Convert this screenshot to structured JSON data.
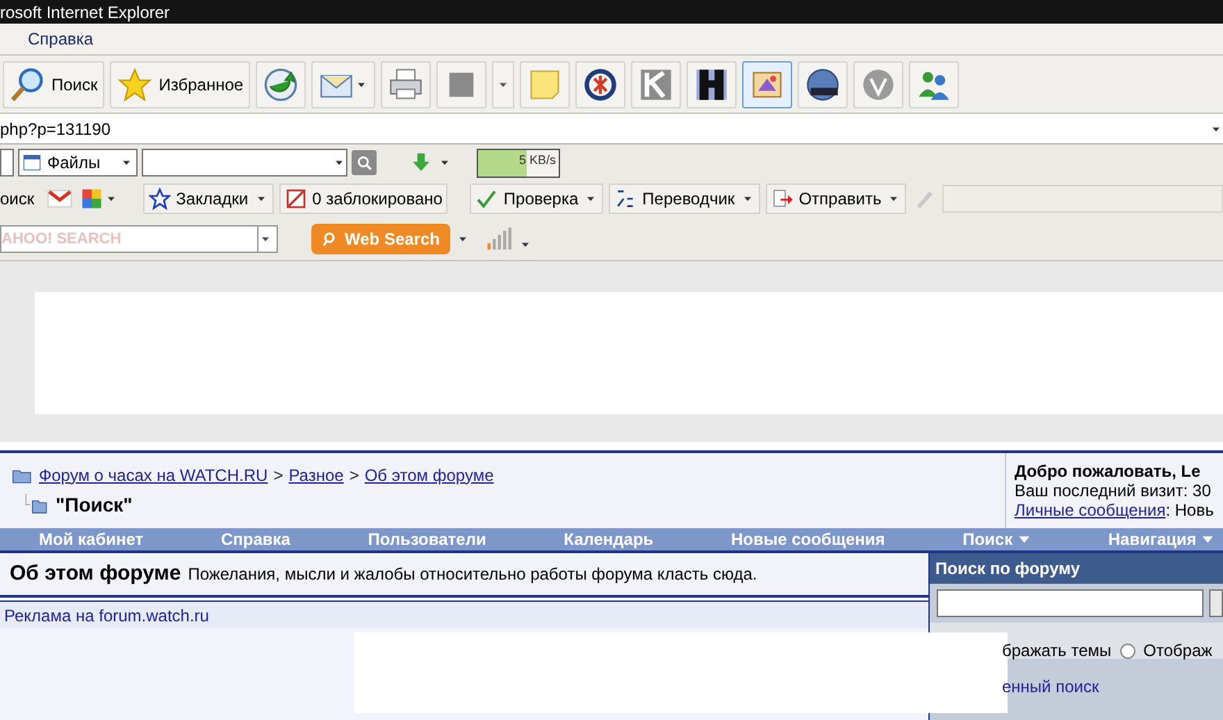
{
  "window": {
    "title": "rosoft Internet Explorer"
  },
  "menu": [
    "Справка"
  ],
  "toolbar": [
    {
      "kind": "labeled",
      "label": "Поиск",
      "selected": false
    },
    {
      "kind": "labeled",
      "label": "Избранное",
      "selected": false
    },
    {
      "kind": "icon",
      "selected": false
    },
    {
      "kind": "icon",
      "selected": false
    },
    {
      "kind": "icon",
      "selected": false
    },
    {
      "kind": "icon",
      "selected": false
    },
    {
      "kind": "icon",
      "selected": false
    },
    {
      "kind": "icon",
      "selected": false
    },
    {
      "kind": "icon",
      "selected": false
    },
    {
      "kind": "icon",
      "selected": false
    },
    {
      "kind": "icon",
      "selected": true
    },
    {
      "kind": "icon",
      "selected": false
    },
    {
      "kind": "icon",
      "selected": false
    },
    {
      "kind": "icon",
      "selected": false
    }
  ],
  "address": {
    "value": "php?p=131190"
  },
  "files_toolbar": {
    "dropdown": "Файлы",
    "speed": "5 KB/s",
    "level": 0.6
  },
  "links_toolbar": {
    "search_fragment": "оиск",
    "bookmarks": "Закладки",
    "blocked": "0 заблокировано",
    "spellcheck": "Проверка",
    "translator": "Переводчик",
    "send": "Отправить"
  },
  "yahoo_toolbar": {
    "placeholder": "AHOO! SEARCH",
    "button": "Web Search"
  },
  "breadcrumb": {
    "links": [
      "Форум о часах на WATCH.RU",
      "Разное",
      "Об этом форуме"
    ],
    "separator": ">",
    "current": "\"Поиск\""
  },
  "welcome": {
    "title": "Добро пожаловать, Le",
    "last_visit": "Ваш последний визит: 30",
    "pm_link": "Личные сообщения",
    "pm_rest": ": Новь"
  },
  "navbar": [
    {
      "label": "Мой кабинет",
      "dropdown": false
    },
    {
      "label": "Справка",
      "dropdown": false
    },
    {
      "label": "Пользователи",
      "dropdown": false
    },
    {
      "label": "Календарь",
      "dropdown": false
    },
    {
      "label": "Новые сообщения",
      "dropdown": false
    },
    {
      "label": "Поиск",
      "dropdown": true
    },
    {
      "label": "Навигация",
      "dropdown": true
    }
  ],
  "forum": {
    "title": "Об этом форуме",
    "description": "Пожелания, мысли и жалобы относительно работы форума класть сюда."
  },
  "ad_label": "Реклама на forum.watch.ru",
  "search_panel": {
    "title": "Поиск по форуму",
    "option_1": "бражать темы",
    "option_2": "Отображ",
    "option_2_selected": false,
    "advanced": "енный поиск"
  }
}
